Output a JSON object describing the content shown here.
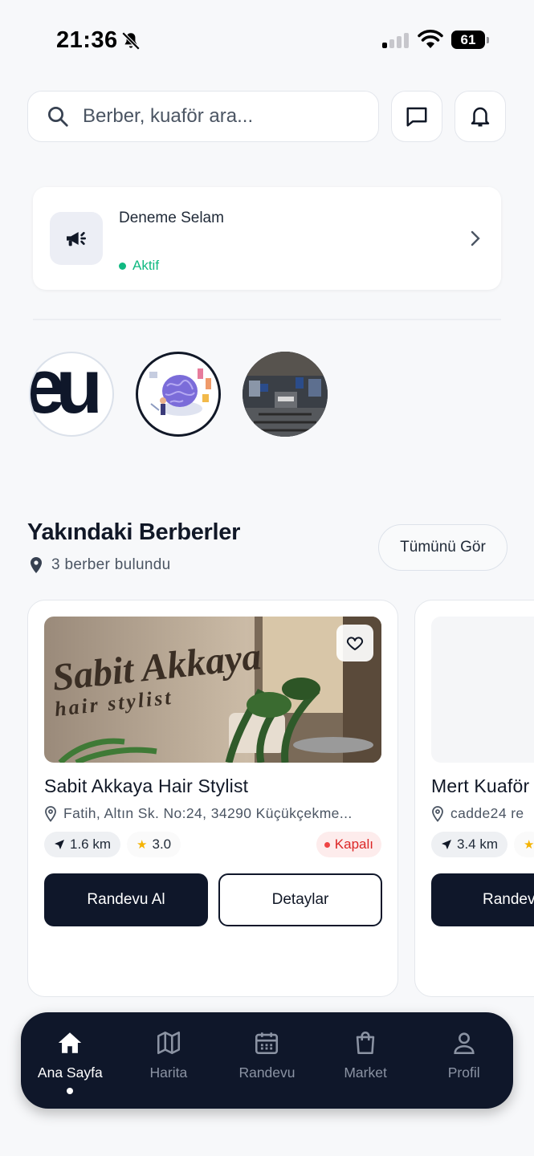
{
  "status_bar": {
    "time": "21:36",
    "battery": "61"
  },
  "search": {
    "placeholder": "Berber, kuaför ara..."
  },
  "announcement": {
    "title": "Deneme Selam",
    "status": "Aktif"
  },
  "stories": [
    {
      "name": "story-1",
      "logo_text": "eu"
    },
    {
      "name": "story-2"
    },
    {
      "name": "story-3"
    }
  ],
  "section": {
    "title": "Yakındaki Berberler",
    "subtitle": "3 berber bulundu",
    "see_all": "Tümünü Gör"
  },
  "barbers": [
    {
      "name": "Sabit Akkaya Hair Stylist",
      "address": "Fatih, Altın Sk. No:24, 34290 Küçükçekme...",
      "distance": "1.6 km",
      "rating": "3.0",
      "status": "Kapalı",
      "book_label": "Randevu Al",
      "details_label": "Detaylar",
      "photo_sign_line1": "Sabit Akkaya",
      "photo_sign_line2": "hair stylist"
    },
    {
      "name": "Mert Kuaför",
      "address": "cadde24 re",
      "distance": "3.4 km",
      "book_label": "Randevu"
    }
  ],
  "nav": [
    {
      "label": "Ana Sayfa",
      "icon": "home-icon",
      "active": true
    },
    {
      "label": "Harita",
      "icon": "map-icon"
    },
    {
      "label": "Randevu",
      "icon": "calendar-icon"
    },
    {
      "label": "Market",
      "icon": "shopping-bag-icon"
    },
    {
      "label": "Profil",
      "icon": "user-icon"
    }
  ],
  "colors": {
    "primary": "#0f172a",
    "success": "#10b981",
    "danger": "#dc2626",
    "star": "#f5b301"
  }
}
